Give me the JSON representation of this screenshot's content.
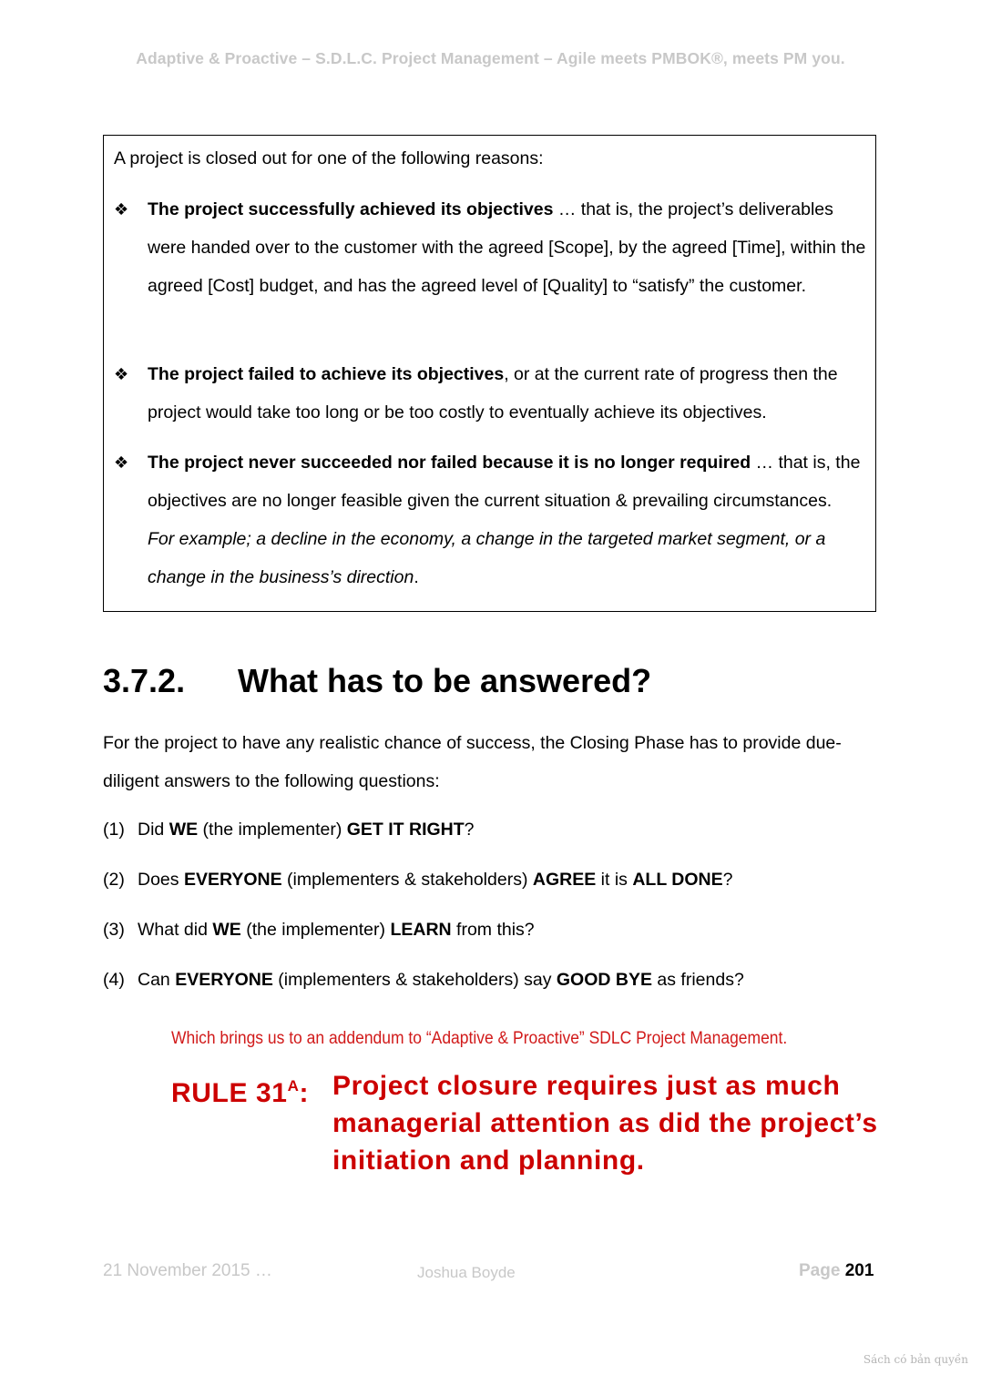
{
  "header": {
    "running_title": "Adaptive & Proactive – S.D.L.C. Project Management – Agile meets PMBOK®, meets PM you."
  },
  "box": {
    "intro": "A project is closed out for one of the following reasons:",
    "bullet_icon": "four-diamond-bullet-icon",
    "bullets": [
      {
        "bold": "The project successfully achieved its objectives",
        "rest": " … that is, the project’s deliverables were handed over to the customer with the agreed [Scope], by the agreed [Time], within the agreed [Cost] budget, and has the agreed level of [Quality] to “satisfy” the customer.",
        "italic": "",
        "end": ""
      },
      {
        "bold": "The project failed to achieve its objectives",
        "rest": ", or at the current rate of progress then the project would take too long or be too costly to eventually achieve its objectives.",
        "italic": "",
        "end": ""
      },
      {
        "bold": "The project never succeeded nor failed because it is no longer required",
        "rest": " … that is, the objectives are no longer feasible given the current situation & prevailing circumstances.  ",
        "italic": "For example; a decline in the economy, a change in the targeted market segment, or a change in the business’s direction",
        "end": "."
      }
    ]
  },
  "section": {
    "number": "3.7.2.",
    "title": "What has to be answered?",
    "paragraph": "For the project to have any realistic chance of success, the Closing Phase has to provide due-diligent answers to the following questions:"
  },
  "questions": [
    {
      "n": "(1)",
      "parts": [
        [
          "t",
          "Did "
        ],
        [
          "b",
          "WE"
        ],
        [
          "t",
          " (the implementer) "
        ],
        [
          "b",
          "GET IT RIGHT"
        ],
        [
          "t",
          "?"
        ]
      ]
    },
    {
      "n": "(2)",
      "parts": [
        [
          "t",
          "Does "
        ],
        [
          "b",
          "EVERYONE"
        ],
        [
          "t",
          " (implementers & stakeholders) "
        ],
        [
          "b",
          "AGREE"
        ],
        [
          "t",
          " it is "
        ],
        [
          "b",
          "ALL DONE"
        ],
        [
          "t",
          "?"
        ]
      ]
    },
    {
      "n": "(3)",
      "parts": [
        [
          "t",
          "What did "
        ],
        [
          "b",
          "WE"
        ],
        [
          "t",
          " (the implementer) "
        ],
        [
          "b",
          "LEARN"
        ],
        [
          "t",
          " from this?"
        ]
      ]
    },
    {
      "n": "(4)",
      "parts": [
        [
          "t",
          "Can "
        ],
        [
          "b",
          "EVERYONE"
        ],
        [
          "t",
          " (implementers & stakeholders) say "
        ],
        [
          "b",
          "GOOD BYE"
        ],
        [
          "t",
          " as friends?"
        ]
      ]
    }
  ],
  "addendum": "Which brings us to an addendum to “Adaptive & Proactive” SDLC Project Management.",
  "rule": {
    "label": "RULE 31",
    "superscript": "A",
    "colon": ":",
    "text": "Project closure requires just as much managerial attention as did the project’s initiation and planning."
  },
  "footer": {
    "date": "21 November 2015 …",
    "author": "Joshua Boyde",
    "page_label": "Page ",
    "page_number": "201"
  },
  "watermark": "Sách có bản quyền",
  "colors": {
    "rule_red": "#cc0000",
    "addendum_red": "#d11a1a",
    "header_gray": "#c8c8c8"
  }
}
